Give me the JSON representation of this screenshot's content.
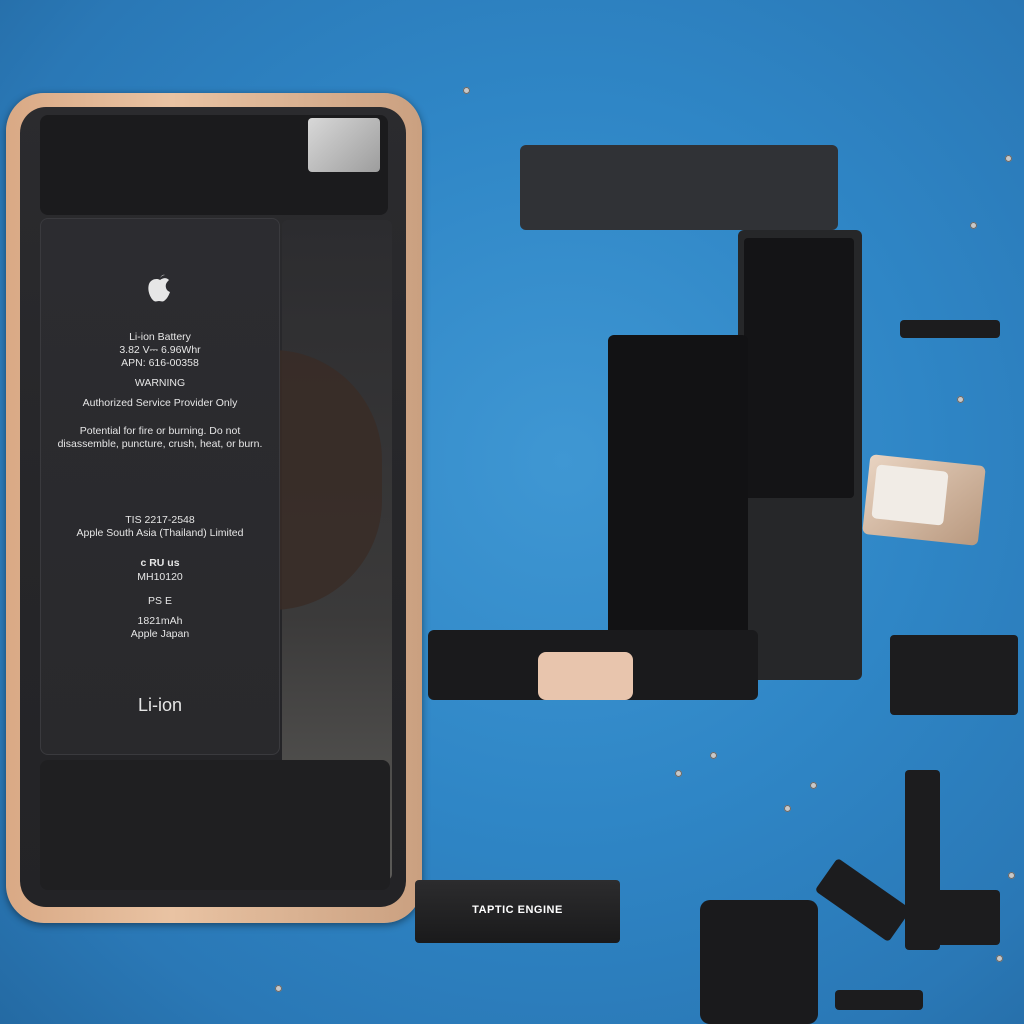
{
  "battery": {
    "apple_logo": "",
    "type": "Li-ion Battery",
    "spec": "3.82 V⎓ 6.96Whr",
    "apn": "APN: 616-00358",
    "warning": "WARNING",
    "auth": "Authorized Service Provider Only",
    "caution": "Potential for fire or burning. Do not disassemble, puncture, crush, heat, or burn.",
    "tis": "TIS 2217-2548",
    "maker": "Apple South Asia (Thailand) Limited",
    "ul": "c RU us",
    "ul_code": "MH10120",
    "pse": "PS E",
    "capacity": "1821mAh",
    "origin": "Apple Japan",
    "recycle": "Li-ion"
  },
  "taptic": {
    "label": " TAPTIC ENGINE"
  }
}
